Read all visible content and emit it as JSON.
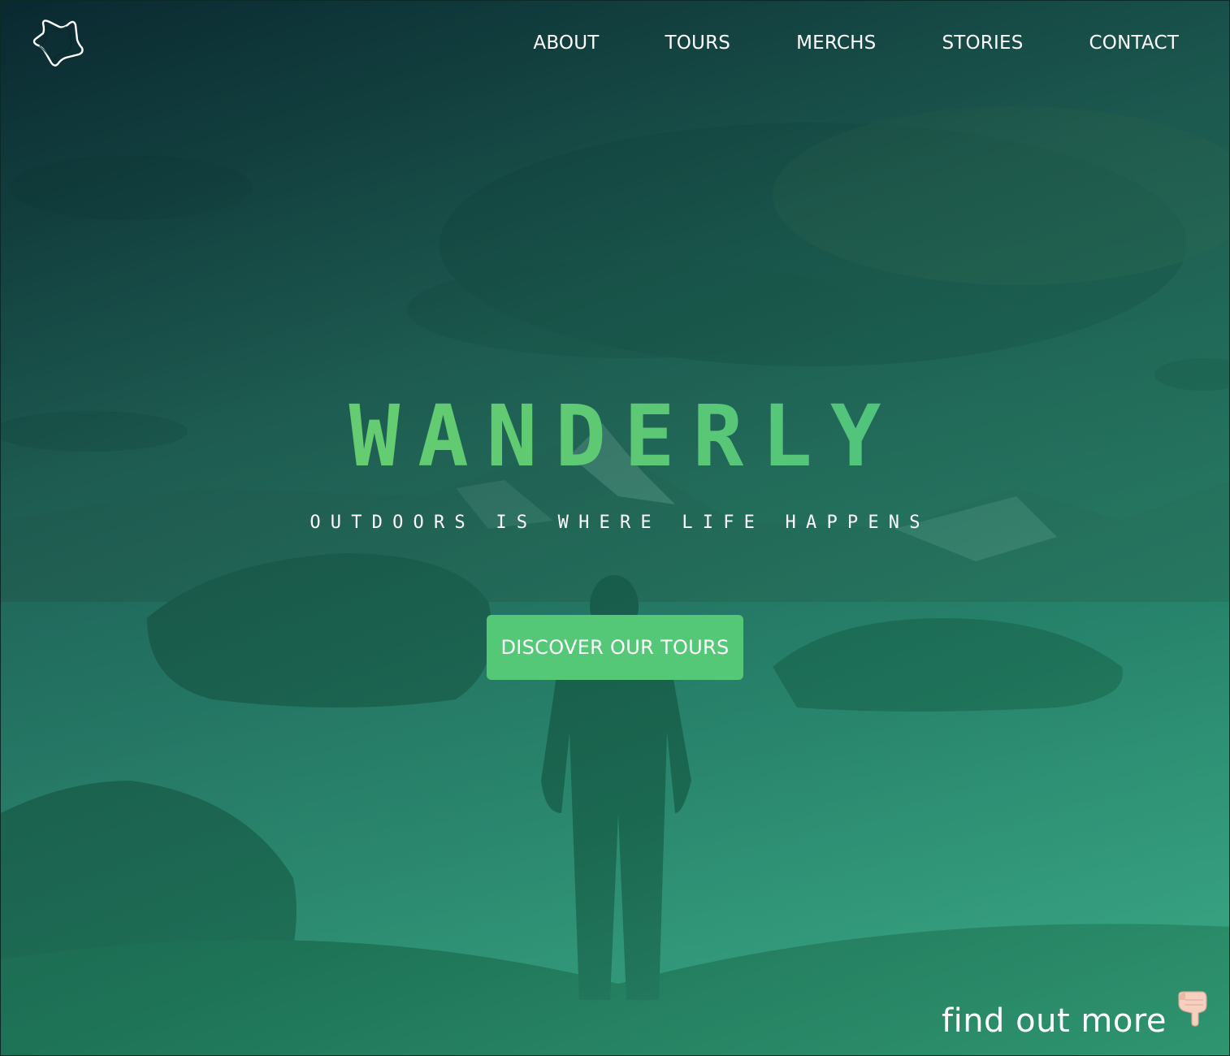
{
  "brand": {
    "logo_icon": "star-outline-icon"
  },
  "nav": {
    "items": [
      {
        "label": "ABOUT"
      },
      {
        "label": "TOURS"
      },
      {
        "label": "MERCHS"
      },
      {
        "label": "STORIES"
      },
      {
        "label": "CONTACT"
      }
    ]
  },
  "hero": {
    "title": "WANDERLY",
    "tagline": "OUTDOORS IS WHERE LIFE HAPPENS",
    "cta_label": "DISCOVER OUR TOURS",
    "find_more_label": "find out more",
    "find_more_icon": "pointing-down-hand-icon",
    "background_image": "mountain-lake-hiker-photo"
  },
  "colors": {
    "accent": "#55c878",
    "title_gradient_start": "#6fd06c",
    "title_gradient_end": "#3fbc86",
    "overlay_dark": "#07262e",
    "overlay_light": "#34aa82"
  }
}
